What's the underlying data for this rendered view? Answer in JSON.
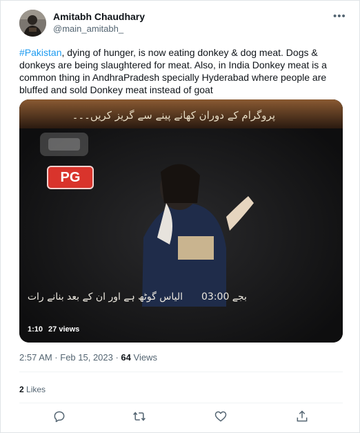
{
  "author": {
    "name": "Amitabh Chaudhary",
    "handle": "@main_amitabh_"
  },
  "tweet": {
    "hashtag": "#Pakistan",
    "text": ", dying of hunger, is now eating donkey & dog meat. Dogs & donkeys are being slaughtered for meat. Also, in India Donkey meat is a common thing in AndhraPradesh specially Hyderabad where people are bluffed and sold Donkey meat instead of goat"
  },
  "video": {
    "overlay_top_urdu": "پروگرام کے دوران کھانے پینے سے گریز کریں۔۔۔",
    "rating_badge": "PG",
    "overlay_bottom_urdu": "الیاس گوٹھ ہے اور ان کے بعد بنانے رات",
    "overlay_time": "03:00 بجے",
    "duration": "1:10",
    "views": "27 views"
  },
  "meta": {
    "time_date": "2:57 AM · Feb 15, 2023 · ",
    "view_count": "64",
    "view_label": " Views",
    "likes_count": "2",
    "likes_label": " Likes"
  },
  "icons": {
    "more": "more-icon",
    "reply": "reply-icon",
    "retweet": "retweet-icon",
    "like": "heart-icon",
    "share": "share-icon"
  },
  "colors": {
    "accent": "#1d9bf0",
    "secondary_text": "#536471",
    "pg_badge": "#d9342c"
  }
}
